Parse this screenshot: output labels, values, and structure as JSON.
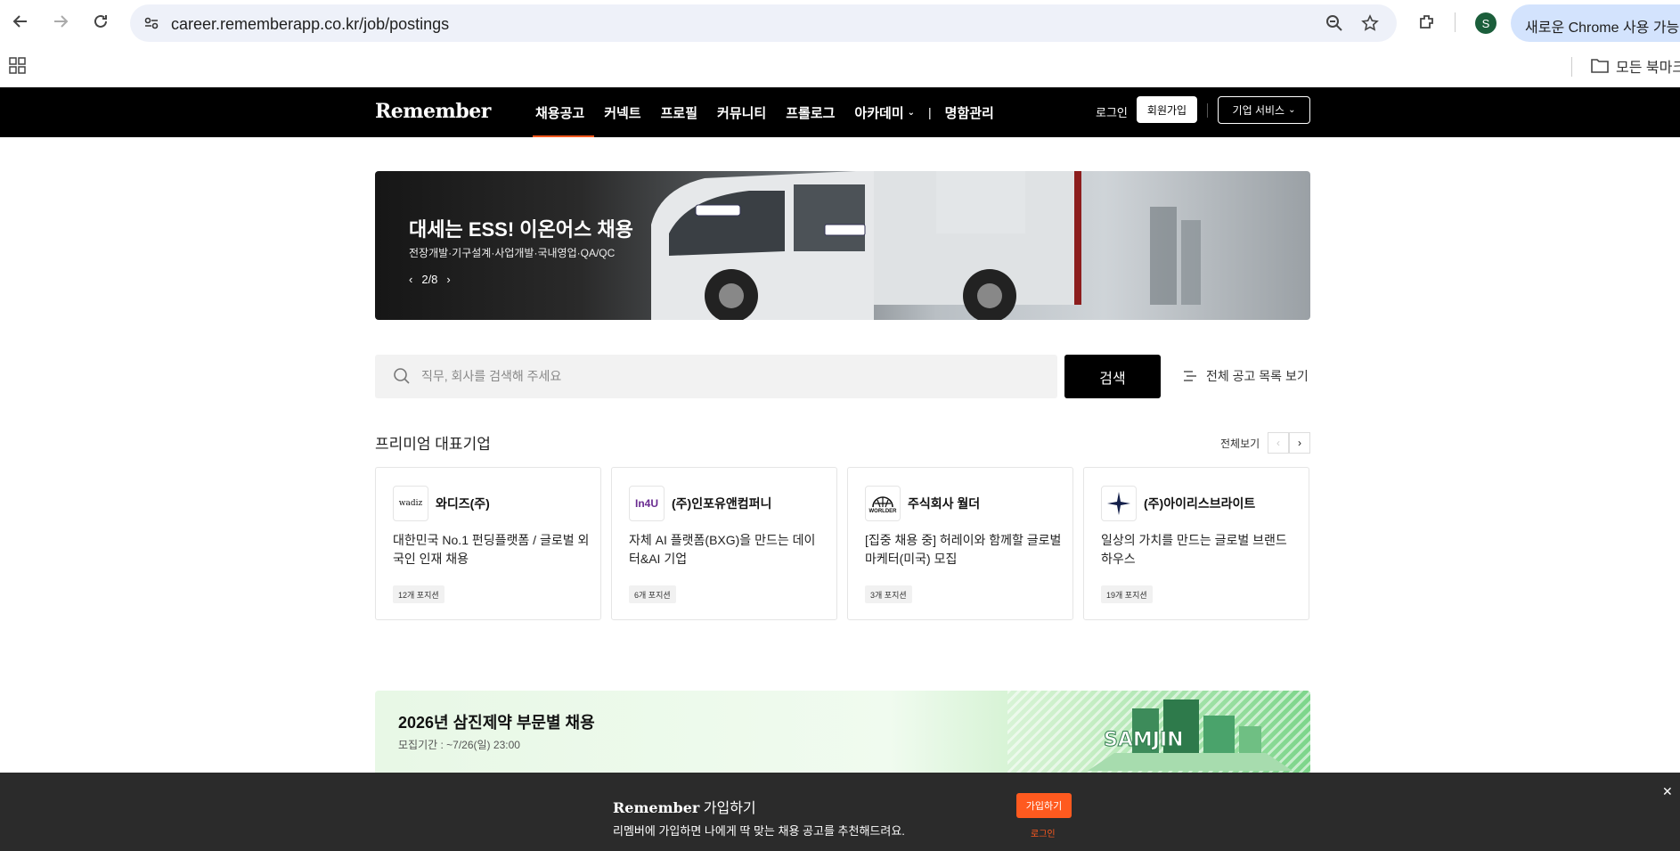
{
  "browser": {
    "url": "career.rememberapp.co.kr/job/postings",
    "profile_initial": "S",
    "chrome_pill": "새로운 Chrome 사용 가능",
    "bookmarks_folder": "모든 북마크"
  },
  "header": {
    "logo": "Remember",
    "nav": [
      {
        "label": "채용공고",
        "active": true
      },
      {
        "label": "커넥트"
      },
      {
        "label": "프로필"
      },
      {
        "label": "커뮤니티"
      },
      {
        "label": "프롤로그"
      },
      {
        "label": "아카데미"
      },
      {
        "label": "명함관리"
      }
    ],
    "login": "로그인",
    "signup": "회원가입",
    "biz_service": "기업 서비스"
  },
  "banner": {
    "title": "대세는 ESS! 이온어스 채용",
    "subtitle": "전장개발·기구설계·사업개발·국내영업·QA/QC",
    "pager": "2/8"
  },
  "search": {
    "placeholder": "직무, 회사를 검색해 주세요",
    "button": "검색",
    "all_list": "전체 공고 목록 보기"
  },
  "premium": {
    "title": "프리미엄 대표기업",
    "see_all": "전체보기",
    "cards": [
      {
        "name": "와디즈(주)",
        "logo_text": "wadiz",
        "desc": "대한민국 No.1 펀딩플랫폼 / 글로벌 외국인 인재 채용",
        "badge": "12개 포지션"
      },
      {
        "name": "(주)인포유앤컴퍼니",
        "logo_text": "In4U",
        "desc": "자체 AI 플랫폼(BXG)을 만드는 데이터&AI 기업",
        "badge": "6개 포지션"
      },
      {
        "name": "주식회사 월더",
        "logo_text": "WORLDER",
        "desc": "[집중 채용 중] 허레이와 함께할 글로벌 마케터(미국) 모집",
        "badge": "3개 포지션"
      },
      {
        "name": "(주)아이리스브라이트",
        "logo_text": "",
        "desc": "일상의 가치를 만드는 글로벌 브랜드 하우스",
        "badge": "19개 포지션"
      }
    ]
  },
  "samjin": {
    "title": "2026년 삼진제약 부문별 채용",
    "subtitle": "모집기간 : ~7/26(일) 23:00",
    "art_text": "SAMJIN"
  },
  "signup_bar": {
    "brand": "Remember",
    "heading": " 가입하기",
    "text": "리멤버에 가입하면 나에게 딱 맞는 채용 공고를 추천해드려요.",
    "join": "가입하기",
    "login": "로그인"
  },
  "colors": {
    "accent": "#ff5a1f",
    "header_bg": "#000000"
  }
}
